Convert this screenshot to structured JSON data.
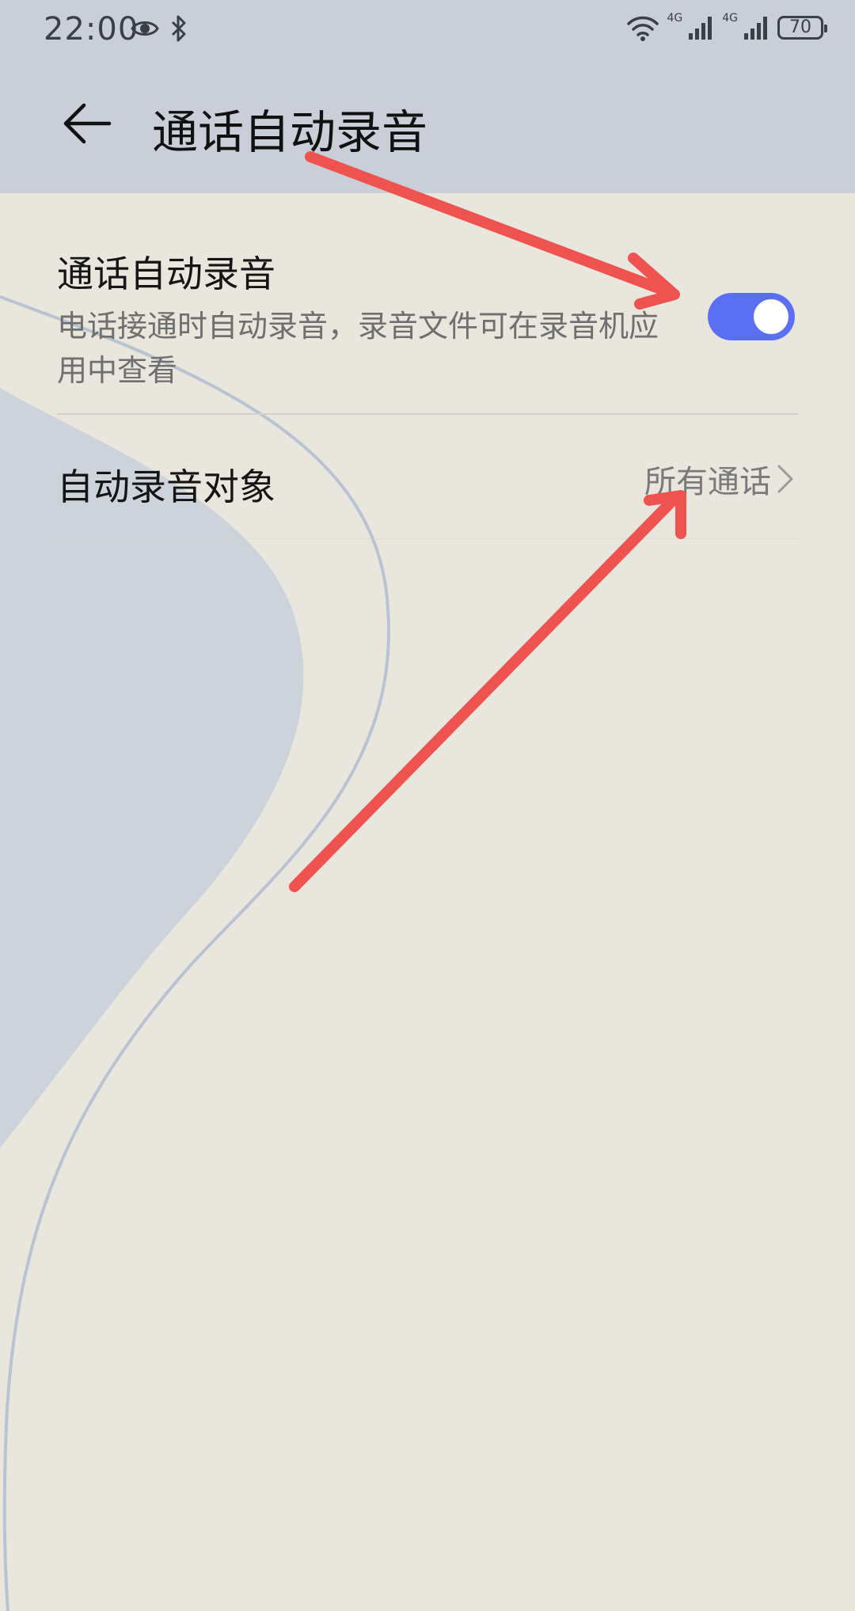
{
  "status_bar": {
    "time": "22:00",
    "network_1": "4G",
    "network_2": "4G",
    "battery": "70"
  },
  "app_bar": {
    "title": "通话自动录音"
  },
  "settings": {
    "auto_record": {
      "title": "通话自动录音",
      "description": "电话接通时自动录音，录音文件可在录音机应用中查看",
      "enabled": true,
      "toggle_color": "#5b6ff4"
    },
    "record_target": {
      "title": "自动录音对象",
      "value": "所有通话"
    }
  },
  "annotation_color": "#ef5350",
  "icons": {
    "back": "arrow-left-icon",
    "eye": "eye-icon",
    "bluetooth": "bluetooth-icon",
    "wifi": "wifi-icon",
    "signal": "signal-icon",
    "battery": "battery-icon",
    "chevron": "chevron-right-icon"
  }
}
